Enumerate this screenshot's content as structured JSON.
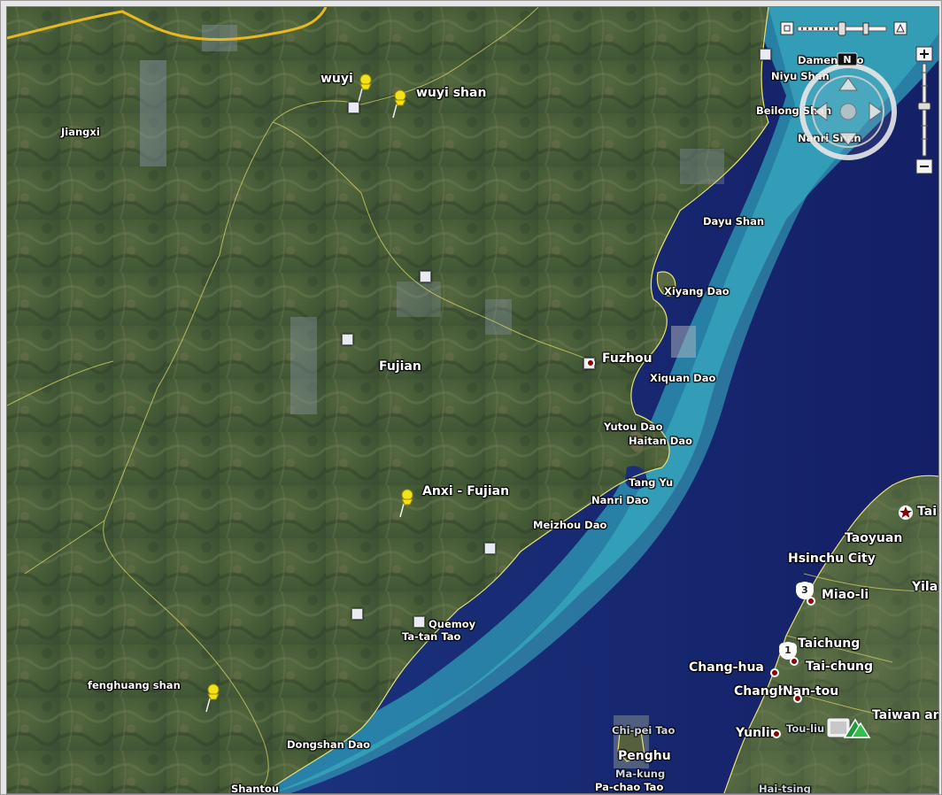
{
  "map": {
    "labels": {
      "wuyi": "wuyi",
      "wuyi_shan": "wuyi shan",
      "jiangxi": "Jiangxi",
      "fujian": "Fujian",
      "fuzhou": "Fuzhou",
      "anxi": "Anxi - Fujian",
      "fenghuang": "fenghuang shan",
      "niyu_shan": "Niyu Shan",
      "damen_dao": "Damen Dao",
      "beilong_shan": "Beilong Shan",
      "nanri_shan": "Nanri Shan",
      "dayu_shan": "Dayu Shan",
      "xiyang_dao": "Xiyang Dao",
      "xiquan_dao": "Xiquan Dao",
      "yutou_dao": "Yutou Dao",
      "haitan_dao": "Haitan Dao",
      "tang_yu": "Tang Yu",
      "nanri_dao": "Nanri Dao",
      "meizhou_dao": "Meizhou Dao",
      "quemoy": "Quemoy",
      "ta_tan_tao": "Ta-tan Tao",
      "dongshan_dao": "Dongshan Dao",
      "shantou": "Shantou",
      "chi_pei_tao": "Chi-pei Tao",
      "penghu": "Penghu",
      "ma_kung": "Ma-kung",
      "pa_chao_tao": "Pa-chao Tao",
      "taoyuan": "Taoyuan",
      "hsinchu": "Hsinchu City",
      "miao_li": "Miao-li",
      "yila": "Yila",
      "tai": "Tai",
      "taichung": "Taichung",
      "tai_chung": "Tai-chung",
      "chang_hua": "Chang-hua",
      "changhua": "Changhua",
      "nan_tou": "Nan-tou",
      "yunlin": "Yunlin",
      "tou_liu": "Tou-liu",
      "taiwan": "Taiwan an",
      "hai_tsing": "Hai-tsing"
    },
    "clusters": {
      "miaoli_count": "3",
      "taichung_count": "1"
    },
    "controls": {
      "north": "N"
    },
    "colors": {
      "sea_deep": "#1a2c7a",
      "sea_shallow": "#2fa6b8",
      "land": "#4a5e38",
      "border": "#e8e070",
      "pin": "#f2e21a",
      "city_dot": "#8b0000"
    },
    "icons": [
      "pushpin-icon",
      "photo-square-icon",
      "city-dot-icon",
      "compass-icon",
      "zoom-plus-icon",
      "zoom-minus-icon",
      "hiker-icon",
      "star-capital-icon"
    ]
  }
}
